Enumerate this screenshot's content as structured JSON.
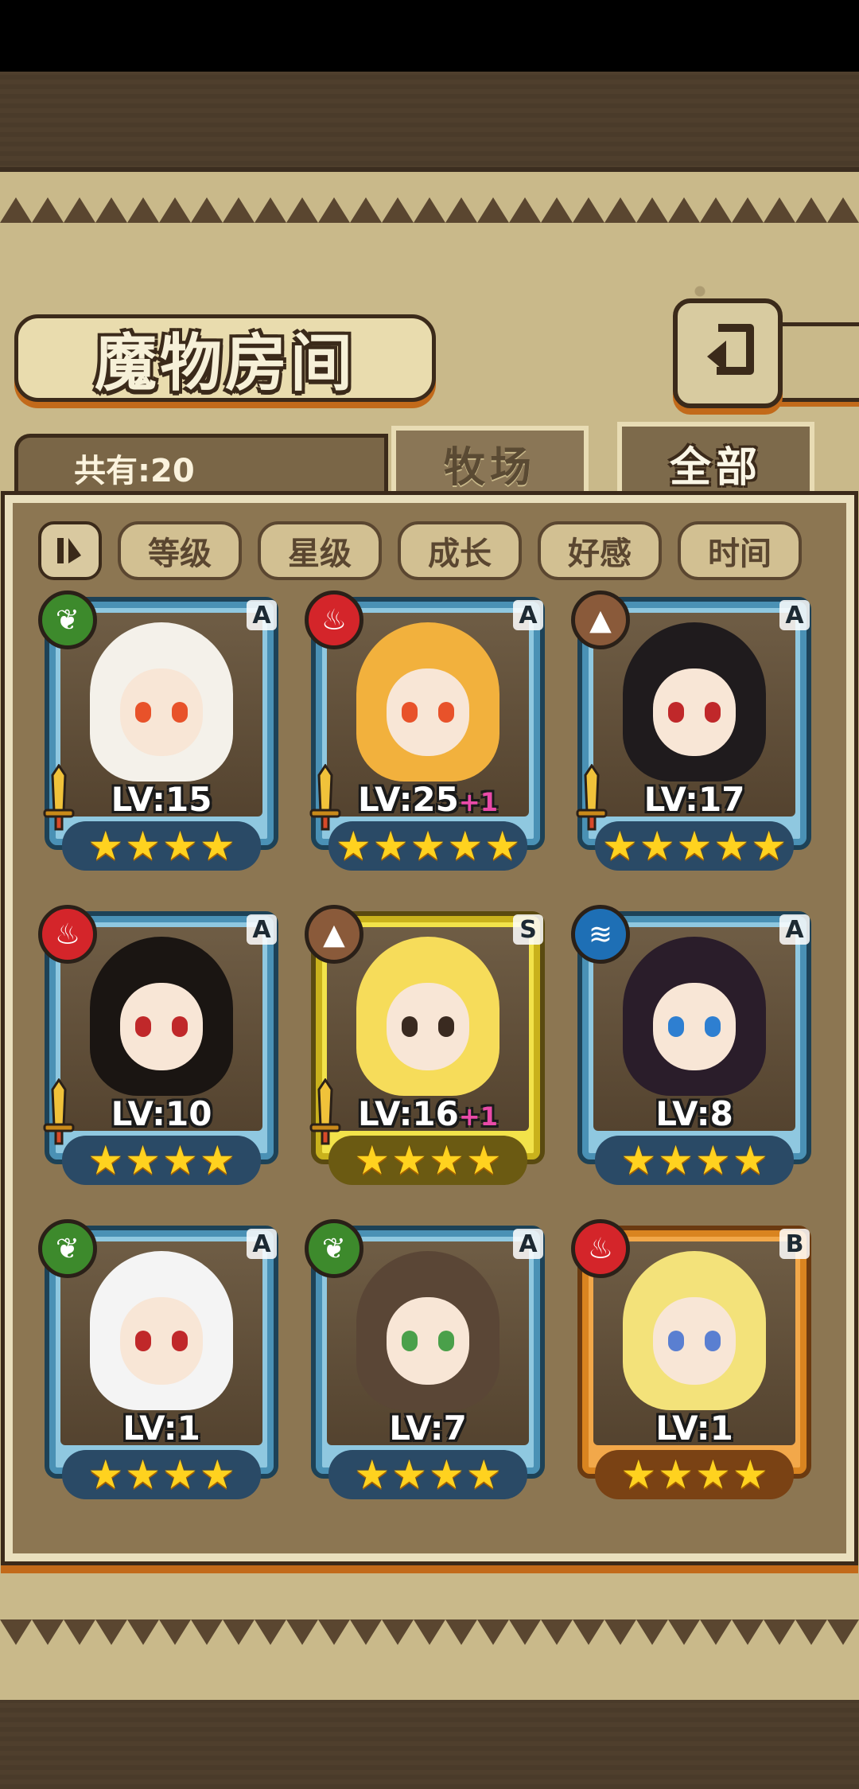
{
  "title": "魔物房间",
  "count_label": "共有:20",
  "tabs": [
    {
      "label": "牧场",
      "active": false
    },
    {
      "label": "全部",
      "active": true
    }
  ],
  "filters": [
    "等级",
    "星级",
    "成长",
    "好感",
    "时间"
  ],
  "filter_toggle_icon": "sort-toggle-icon",
  "back_icon": "back-arrow-icon",
  "monsters": [
    {
      "element": "leaf",
      "rank": "A",
      "level": "LV:15",
      "bonus": "",
      "stars": 4,
      "sword": true,
      "hair": "#f4f1ea",
      "eyes": "#e8522a"
    },
    {
      "element": "fire",
      "rank": "A",
      "level": "LV:25",
      "bonus": "+1",
      "stars": 5,
      "sword": true,
      "hair": "#f2b13d",
      "eyes": "#e8522a"
    },
    {
      "element": "earth",
      "rank": "A",
      "level": "LV:17",
      "bonus": "",
      "stars": 5,
      "sword": true,
      "hair": "#1f1b1d",
      "eyes": "#c0282a"
    },
    {
      "element": "fire",
      "rank": "A",
      "level": "LV:10",
      "bonus": "",
      "stars": 4,
      "sword": true,
      "hair": "#1a1512",
      "eyes": "#c0282a"
    },
    {
      "element": "earth",
      "rank": "S",
      "level": "LV:16",
      "bonus": "+1",
      "stars": 4,
      "sword": true,
      "hair": "#f6dc5a",
      "eyes": "#3a2a20"
    },
    {
      "element": "water",
      "rank": "A",
      "level": "LV:8",
      "bonus": "",
      "stars": 4,
      "sword": false,
      "hair": "#2a1d2a",
      "eyes": "#2e7fd1"
    },
    {
      "element": "leaf",
      "rank": "A",
      "level": "LV:1",
      "bonus": "",
      "stars": 4,
      "sword": false,
      "hair": "#f4f4f4",
      "eyes": "#c0282a"
    },
    {
      "element": "leaf",
      "rank": "A",
      "level": "LV:7",
      "bonus": "",
      "stars": 4,
      "sword": false,
      "hair": "#5a4636",
      "eyes": "#4aa04a"
    },
    {
      "element": "fire",
      "rank": "B",
      "level": "LV:1",
      "bonus": "",
      "stars": 4,
      "sword": false,
      "hair": "#f3e27a",
      "eyes": "#5a7fd1"
    }
  ],
  "colors": {
    "parchment": "#c9b98a",
    "panel": "#8c7652",
    "frame_A": "#4a91b5",
    "frame_S": "#c9b21c",
    "frame_B": "#d98420",
    "star": "#ffd21f"
  }
}
